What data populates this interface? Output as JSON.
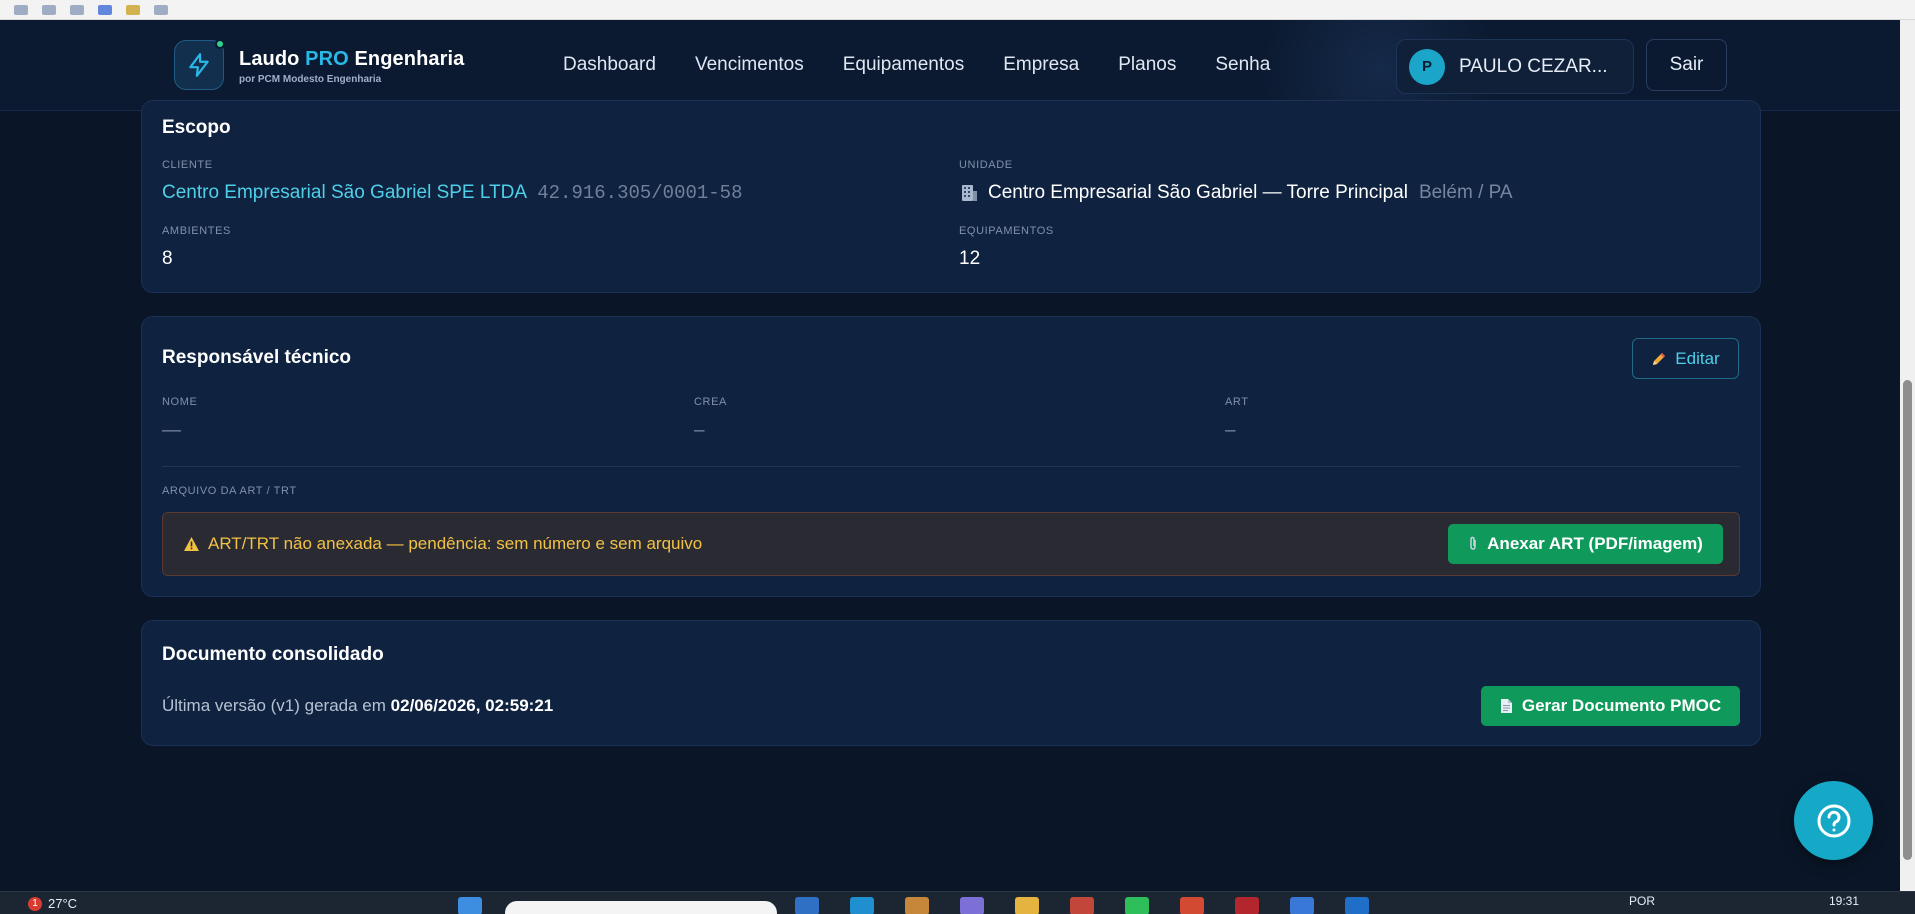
{
  "header": {
    "brand_part1": "Laudo",
    "brand_pro": "PRO",
    "brand_part2": "Engenharia",
    "brand_subtitle": "por PCM Modesto Engenharia",
    "nav": [
      "Dashboard",
      "Vencimentos",
      "Equipamentos",
      "Empresa",
      "Planos",
      "Senha"
    ],
    "user_initial": "P",
    "user_name": "PAULO CEZAR...",
    "logout_label": "Sair"
  },
  "scope": {
    "title": "Escopo",
    "client_label": "CLIENTE",
    "client_name": "Centro Empresarial São Gabriel SPE LTDA",
    "client_cnpj": "42.916.305/0001-58",
    "unit_label": "UNIDADE",
    "unit_icon": "building-icon",
    "unit_name": "Centro Empresarial São Gabriel — Torre Principal",
    "unit_location": "Belém / PA",
    "environments_label": "AMBIENTES",
    "environments_value": "8",
    "equipment_label": "EQUIPAMENTOS",
    "equipment_value": "12"
  },
  "technical": {
    "title": "Responsável técnico",
    "edit_label": "Editar",
    "name_label": "NOME",
    "name_value": "—",
    "crea_label": "CREA",
    "crea_value": "–",
    "art_label": "ART",
    "art_value": "–",
    "file_label": "ARQUIVO DA ART / TRT",
    "alert_text": "ART/TRT não anexada — pendência: sem número e sem arquivo",
    "attach_label": "Anexar ART (PDF/imagem)"
  },
  "document": {
    "title": "Documento consolidado",
    "version_text": "Última versão (v1) gerada em",
    "version_date": "02/06/2026, 02:59:21",
    "generate_label": "Gerar Documento PMOC"
  },
  "taskbar": {
    "weather_badge": "1",
    "temperature": "27°C",
    "language": "POR",
    "time": "19:31"
  },
  "colors": {
    "background": "#0a1628",
    "card": "#0f223f",
    "accent": "#4fcfe8",
    "brand_pro": "#2ab8e6",
    "success": "#0f9a5c",
    "warning": "#f2c144"
  }
}
